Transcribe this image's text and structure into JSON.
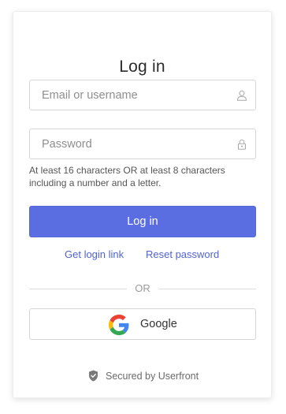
{
  "form": {
    "title": "Log in",
    "email_placeholder": "Email or username",
    "password_placeholder": "Password",
    "password_hint": "At least 16 characters OR at least 8 characters including a number and a letter.",
    "submit_label": "Log in"
  },
  "links": {
    "get_login_link": "Get login link",
    "reset_password": "Reset password"
  },
  "divider": {
    "label": "OR"
  },
  "sso": {
    "google_label": "Google"
  },
  "footer": {
    "secured_text": "Secured by Userfront"
  },
  "colors": {
    "primary": "#5b6ee1",
    "link": "#4f63d2"
  },
  "icons": {
    "email_field": "user-icon",
    "password_field": "lock-icon",
    "google": "google-logo-icon",
    "footer": "shield-check-icon"
  }
}
